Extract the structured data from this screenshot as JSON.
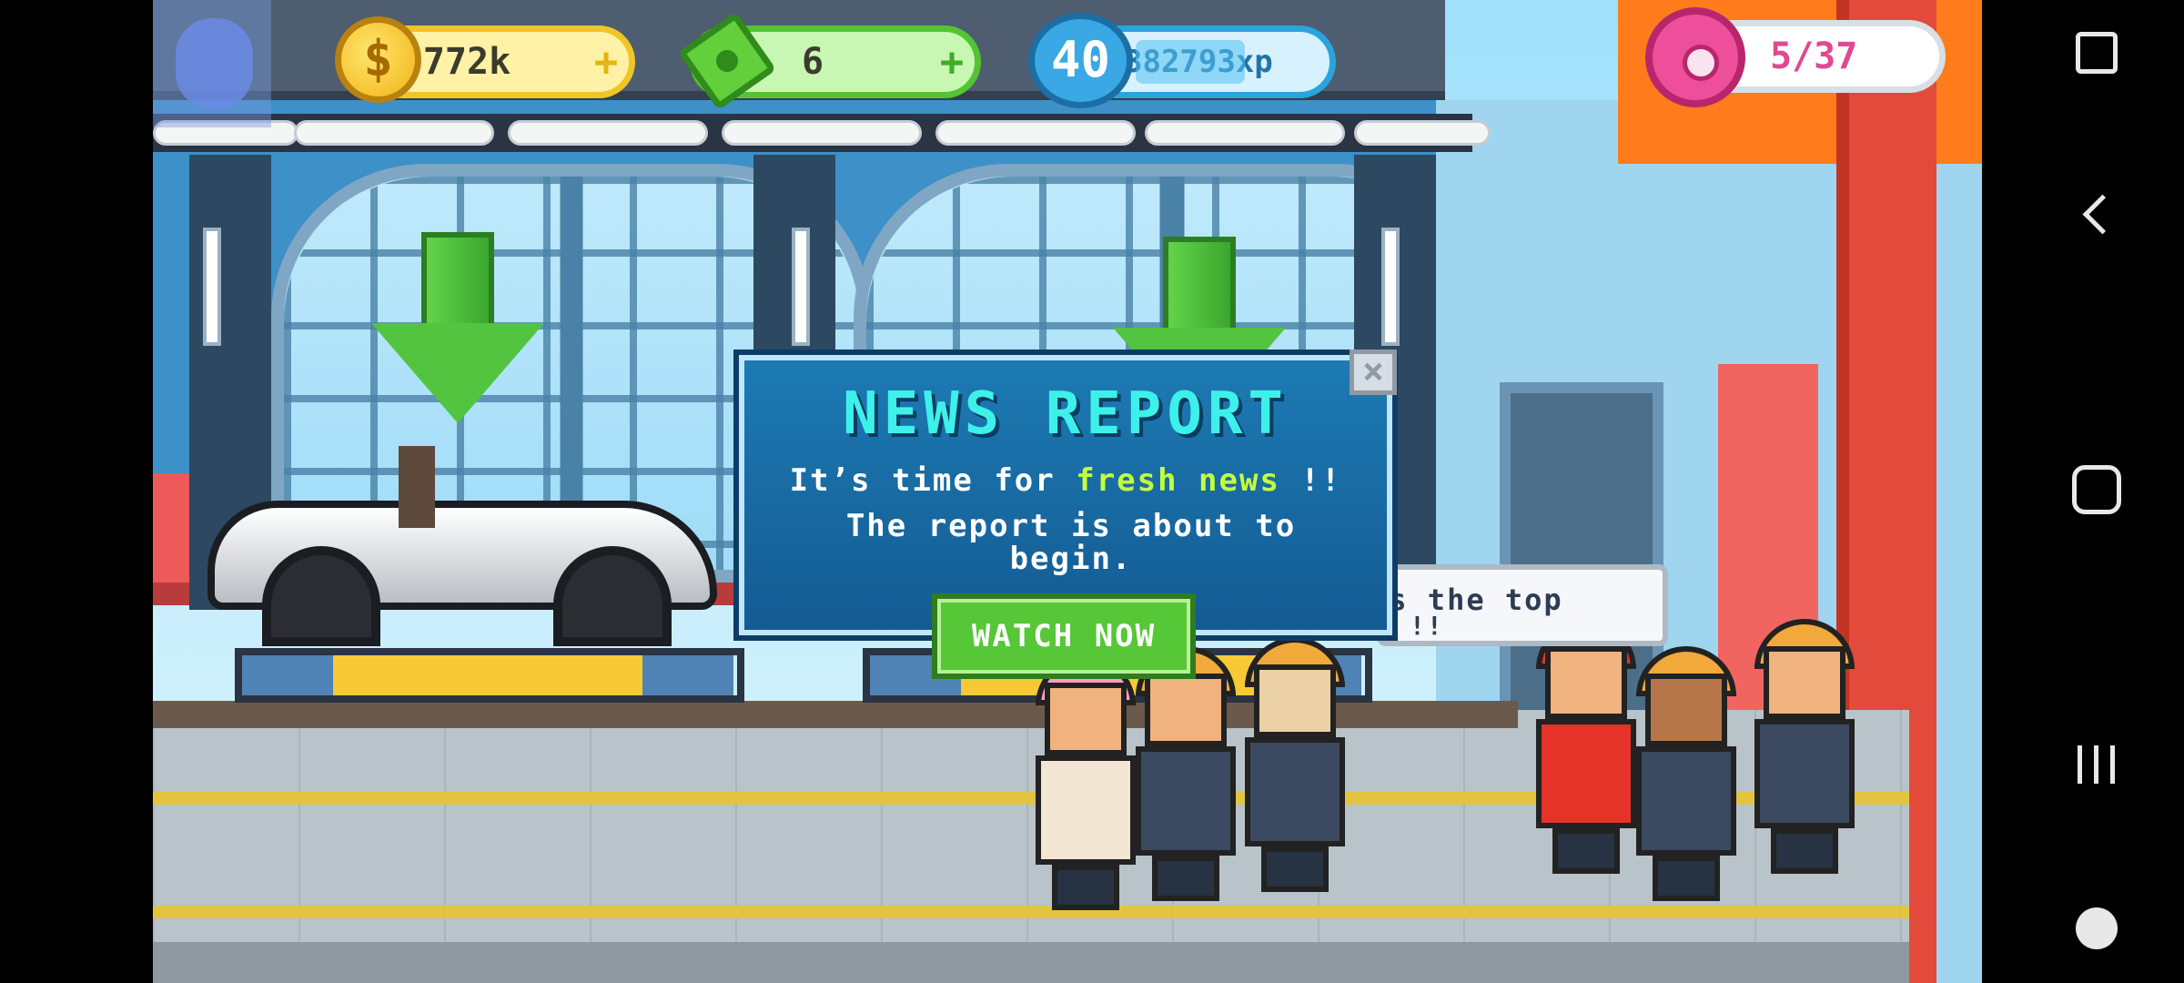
{
  "hud": {
    "coins": "772k",
    "cash": "6",
    "level": "40",
    "xp": "382793xp",
    "donuts": "5/37",
    "plus_symbol": "+"
  },
  "news": {
    "title": "NEWS REPORT",
    "line1_pre": "It’s time for ",
    "line1_highlight": "fresh news",
    "line1_post": " !!",
    "line2": "The report is about to begin.",
    "watch_label": "WATCH NOW",
    "close_symbol": "×"
  },
  "speech": {
    "text_line1": "is the top",
    "text_line2": "!!"
  },
  "icons": {
    "coin": "dollar-coin",
    "cash": "cash-bill",
    "level": "level-badge",
    "donut": "donut",
    "close": "close"
  },
  "colors": {
    "title_cyan": "#3df1ea",
    "highlight_green": "#c4ff3e",
    "button_green": "#56c736",
    "donut_pink": "#e24893"
  },
  "navbar": {
    "items": [
      "tool",
      "back",
      "home",
      "recents",
      "game-launcher"
    ]
  }
}
